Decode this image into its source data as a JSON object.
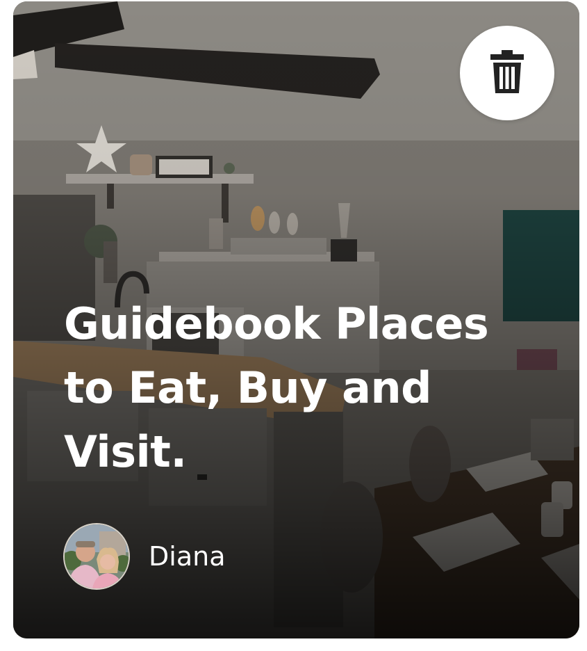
{
  "card": {
    "title": "Guidebook Places to Eat, Buy and Visit.",
    "author": {
      "name": "Diana"
    },
    "delete_button": {
      "icon": "trash-icon"
    },
    "cover_image": {
      "subject": "kitchen-and-dining-room-photo"
    }
  },
  "colors": {
    "title_text": "#ffffff",
    "button_bg": "#ffffff",
    "icon": "#222222"
  }
}
